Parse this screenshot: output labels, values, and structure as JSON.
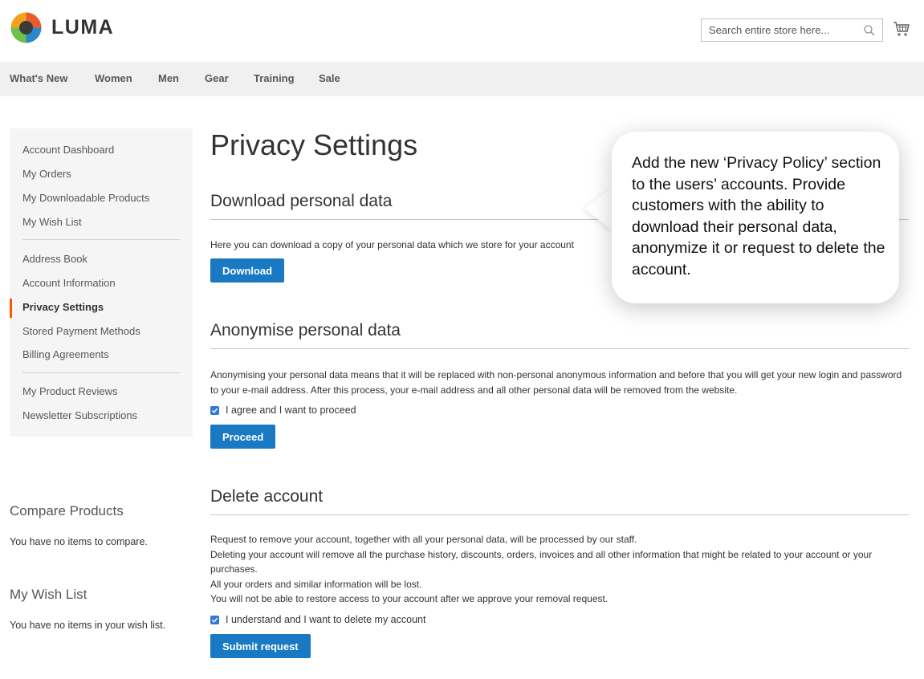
{
  "header": {
    "logo_text": "LUMA",
    "search_placeholder": "Search entire store here..."
  },
  "nav": [
    "What's New",
    "Women",
    "Men",
    "Gear",
    "Training",
    "Sale"
  ],
  "sidebar": {
    "items": [
      {
        "label": "Account Dashboard"
      },
      {
        "label": "My Orders"
      },
      {
        "label": "My Downloadable Products"
      },
      {
        "label": "My Wish List"
      },
      {
        "label": "Address Book"
      },
      {
        "label": "Account Information"
      },
      {
        "label": "Privacy Settings",
        "active": true
      },
      {
        "label": "Stored Payment Methods"
      },
      {
        "label": "Billing Agreements"
      },
      {
        "label": "My Product Reviews"
      },
      {
        "label": "Newsletter Subscriptions"
      }
    ],
    "compare": {
      "title": "Compare Products",
      "text": "You have no items to compare."
    },
    "wishlist": {
      "title": "My Wish List",
      "text": "You have no items in your wish list."
    }
  },
  "main": {
    "page_title": "Privacy Settings",
    "download": {
      "title": "Download personal data",
      "text": "Here you can download a copy of your personal data which we store for your account",
      "button": "Download"
    },
    "anonymise": {
      "title": "Anonymise personal data",
      "text": "Anonymising your personal data means that it will be replaced with non-personal anonymous information and before that you will get your new login and password to your e-mail address. After this process, your e-mail address and all other personal data will be removed from the website.",
      "checkbox": "I agree and I want to proceed",
      "button": "Proceed"
    },
    "delete": {
      "title": "Delete account",
      "lines": [
        "Request to remove your account, together with all your personal data, will be processed by our staff.",
        "Deleting your account will remove all the purchase history, discounts, orders, invoices and all other information that might be related to your account or your purchases.",
        "All your orders and similar information will be lost.",
        "You will not be able to restore access to your account after we approve your removal request."
      ],
      "checkbox": "I understand and I want to delete my account",
      "button": "Submit request"
    }
  },
  "callout": {
    "text": "Add the new ‘Privacy Policy’ section to the users’ accounts. Provide customers with the ability to download their personal data, anonymize it or request to delete the account."
  },
  "colors": {
    "accent": "#1979c3",
    "active_marker": "#ff5501",
    "nav_bg": "#f0f0f0",
    "sidebar_bg": "#f5f5f5"
  }
}
